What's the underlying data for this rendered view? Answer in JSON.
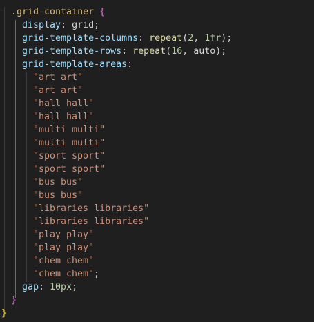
{
  "code": {
    "selector": ".grid-container",
    "open_brace": "{",
    "display_prop": "display",
    "display_value": "grid",
    "cols_prop": "grid-template-columns",
    "cols_func": "repeat",
    "cols_count": "2",
    "cols_size": "1fr",
    "rows_prop": "grid-template-rows",
    "rows_func": "repeat",
    "rows_count": "16",
    "rows_size": "auto",
    "areas_prop": "grid-template-areas",
    "areas": [
      "\"art art\"",
      "\"art art\"",
      "\"hall hall\"",
      "\"hall hall\"",
      "\"multi multi\"",
      "\"multi multi\"",
      "\"sport sport\"",
      "\"sport sport\"",
      "\"bus bus\"",
      "\"bus bus\"",
      "\"libraries libraries\"",
      "\"libraries libraries\"",
      "\"play play\"",
      "\"play play\"",
      "\"chem chem\"",
      "\"chem chem\""
    ],
    "gap_prop": "gap",
    "gap_value": "10px",
    "close_brace": "}",
    "outer_close_brace": "}"
  },
  "colors": {
    "background": "#1f1f1f",
    "selector": "#d7ba7d",
    "property": "#9cdcfe",
    "string": "#ce9178",
    "number": "#b5cea8",
    "function": "#dcdcaa",
    "brace_inner": "#da70d6",
    "brace_outer": "#ffd700"
  }
}
